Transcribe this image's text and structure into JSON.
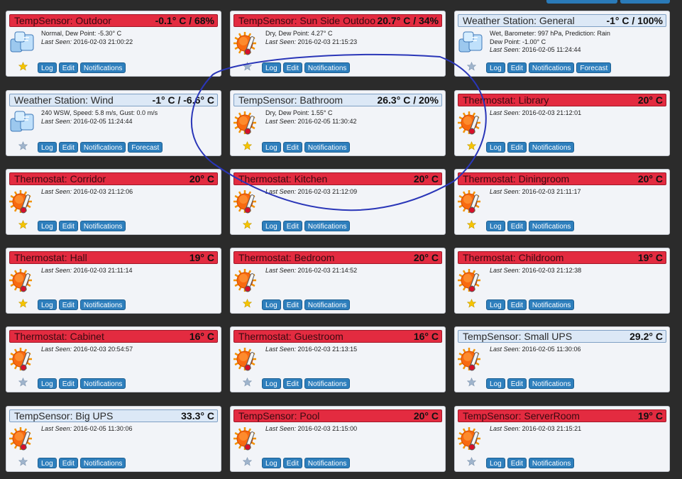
{
  "buttons": {
    "log": "Log",
    "edit": "Edit",
    "notifications": "Notifications",
    "forecast": "Forecast"
  },
  "last_seen_label": "Last Seen:",
  "colors": {
    "red_header": "#e32b40",
    "blue_header": "#dce8f6",
    "button": "#2e7fbd"
  },
  "cards": [
    {
      "type": "TempSensor:",
      "name": "Outdoor",
      "value": "-0.1° C / 68%",
      "status": "Normal, Dew Point: -5.30° C",
      "extra": "",
      "last_seen": "2016-02-03 21:00:22",
      "header": "red",
      "icon": "ice-icon",
      "star": "gold",
      "forecast": false
    },
    {
      "type": "TempSensor:",
      "name": "Sun Side Outdoor",
      "value": "20.7° C / 34%",
      "status": "Dry, Dew Point: 4.27° C",
      "extra": "",
      "last_seen": "2016-02-03 21:15:23",
      "header": "red",
      "icon": "sun-thermometer-icon",
      "star": "blue",
      "forecast": false
    },
    {
      "type": "Weather Station:",
      "name": "General",
      "value": "-1° C / 100%",
      "status": "Wet, Barometer: 997 hPa, Prediction: Rain",
      "extra": "Dew Point: -1.00° C",
      "last_seen": "2016-02-05 11:24:44",
      "header": "blue",
      "icon": "ice-icon",
      "star": "blue",
      "forecast": true
    },
    {
      "type": "Weather Station:",
      "name": "Wind",
      "value": "-1° C / -6.6° C",
      "status": "240 WSW, Speed: 5.8 m/s, Gust: 0.0 m/s",
      "extra": "",
      "last_seen": "2016-02-05 11:24:44",
      "header": "blue",
      "icon": "ice-icon",
      "star": "blue",
      "forecast": true
    },
    {
      "type": "TempSensor:",
      "name": "Bathroom",
      "value": "26.3° C / 20%",
      "status": "Dry, Dew Point: 1.55° C",
      "extra": "",
      "last_seen": "2016-02-05 11:30:42",
      "header": "blue",
      "icon": "sun-thermometer-icon",
      "star": "gold",
      "forecast": false
    },
    {
      "type": "Thermostat:",
      "name": "Library",
      "value": "20° C",
      "status": "",
      "extra": "",
      "last_seen": "2016-02-03 21:12:01",
      "header": "red",
      "icon": "sun-thermometer-icon",
      "star": "gold",
      "forecast": false
    },
    {
      "type": "Thermostat:",
      "name": "Corridor",
      "value": "20° C",
      "status": "",
      "extra": "",
      "last_seen": "2016-02-03 21:12:06",
      "header": "red",
      "icon": "sun-thermometer-icon",
      "star": "gold",
      "forecast": false
    },
    {
      "type": "Thermostat:",
      "name": "Kitchen",
      "value": "20° C",
      "status": "",
      "extra": "",
      "last_seen": "2016-02-03 21:12:09",
      "header": "red",
      "icon": "sun-thermometer-icon",
      "star": "gold",
      "forecast": false
    },
    {
      "type": "Thermostat:",
      "name": "Diningroom",
      "value": "20° C",
      "status": "",
      "extra": "",
      "last_seen": "2016-02-03 21:11:17",
      "header": "red",
      "icon": "sun-thermometer-icon",
      "star": "gold",
      "forecast": false
    },
    {
      "type": "Thermostat:",
      "name": "Hall",
      "value": "19° C",
      "status": "",
      "extra": "",
      "last_seen": "2016-02-03 21:11:14",
      "header": "red",
      "icon": "sun-thermometer-icon",
      "star": "gold",
      "forecast": false
    },
    {
      "type": "Thermostat:",
      "name": "Bedroom",
      "value": "20° C",
      "status": "",
      "extra": "",
      "last_seen": "2016-02-03 21:14:52",
      "header": "red",
      "icon": "sun-thermometer-icon",
      "star": "gold",
      "forecast": false
    },
    {
      "type": "Thermostat:",
      "name": "Childroom",
      "value": "19° C",
      "status": "",
      "extra": "",
      "last_seen": "2016-02-03 21:12:38",
      "header": "red",
      "icon": "sun-thermometer-icon",
      "star": "gold",
      "forecast": false
    },
    {
      "type": "Thermostat:",
      "name": "Cabinet",
      "value": "16° C",
      "status": "",
      "extra": "",
      "last_seen": "2016-02-03 20:54:57",
      "header": "red",
      "icon": "sun-thermometer-icon",
      "star": "blue",
      "forecast": false
    },
    {
      "type": "Thermostat:",
      "name": "Guestroom",
      "value": "16° C",
      "status": "",
      "extra": "",
      "last_seen": "2016-02-03 21:13:15",
      "header": "red",
      "icon": "sun-thermometer-icon",
      "star": "blue",
      "forecast": false
    },
    {
      "type": "TempSensor:",
      "name": "Small UPS",
      "value": "29.2° C",
      "status": "",
      "extra": "",
      "last_seen": "2016-02-05 11:30:06",
      "header": "blue",
      "icon": "sun-thermometer-icon",
      "star": "blue",
      "forecast": false
    },
    {
      "type": "TempSensor:",
      "name": "Big UPS",
      "value": "33.3° C",
      "status": "",
      "extra": "",
      "last_seen": "2016-02-05 11:30:06",
      "header": "blue",
      "icon": "sun-thermometer-icon",
      "star": "blue",
      "forecast": false
    },
    {
      "type": "TempSensor:",
      "name": "Pool",
      "value": "20° C",
      "status": "",
      "extra": "",
      "last_seen": "2016-02-03 21:15:00",
      "header": "red",
      "icon": "sun-thermometer-icon",
      "star": "blue",
      "forecast": false
    },
    {
      "type": "TempSensor:",
      "name": "ServerRoom",
      "value": "19° C",
      "status": "",
      "extra": "",
      "last_seen": "2016-02-03 21:15:21",
      "header": "red",
      "icon": "sun-thermometer-icon",
      "star": "blue",
      "forecast": false
    }
  ]
}
